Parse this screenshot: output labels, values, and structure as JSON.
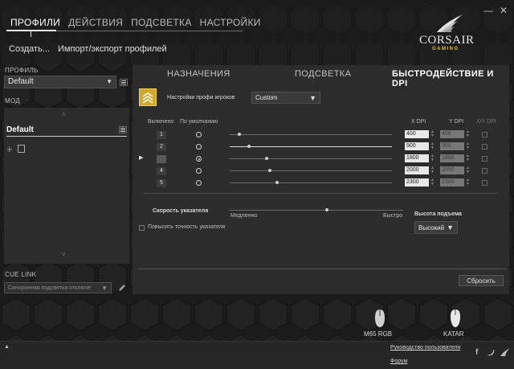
{
  "nav": {
    "tabs": [
      "ПРОФИЛИ",
      "ДЕЙСТВИЯ",
      "ПОДСВЕТКА",
      "НАСТРОЙКИ"
    ],
    "active_tab": "ПРОФИЛИ"
  },
  "window_controls": [
    "minimize-icon",
    "close-icon"
  ],
  "logo": {
    "brand": "CORSAIR",
    "tagline": "GAMING"
  },
  "subnav": {
    "create": "Создать...",
    "import_export": "Импорт/экспорт профилей"
  },
  "profile": {
    "label": "ПРОФИЛЬ",
    "selected": "Default"
  },
  "mode": {
    "label": "МОД",
    "selected": "Default"
  },
  "cue_link": {
    "label": "CUE LINK",
    "selected": "Синхронная подсветка отключе"
  },
  "main_tabs": [
    "НАЗНАЧЕНИЯ",
    "ПОДСВЕТКА",
    "БЫСТРОДЕЙСТВИЕ И DPI"
  ],
  "active_main_tab": "БЫСТРОДЕЙСТВИЕ И DPI",
  "gamer_settings": {
    "label": "Настройки профи игроков",
    "selected": "Custom"
  },
  "dpi_table": {
    "headers": {
      "enabled": "Включено",
      "default": "По умолчанию",
      "xdpi": "X DPI",
      "ydpi": "Y DPI",
      "xy": "X/Y DPI"
    },
    "rows": [
      {
        "num": "1",
        "x": "400",
        "y": "400",
        "default": false,
        "slider": 0.05,
        "bright": false
      },
      {
        "num": "2",
        "x": "900",
        "y": "900",
        "default": false,
        "slider": 0.11,
        "bright": true
      },
      {
        "num": "3",
        "x": "1800",
        "y": "1800",
        "default": true,
        "slider": 0.22,
        "bright": false
      },
      {
        "num": "4",
        "x": "2000",
        "y": "2000",
        "default": false,
        "slider": 0.24,
        "bright": false
      },
      {
        "num": "5",
        "x": "2300",
        "y": "2300",
        "default": false,
        "slider": 0.28,
        "bright": false
      }
    ],
    "active_row_index": 2
  },
  "pointer_speed": {
    "label": "Скорость указателя",
    "min_label": "Медленно",
    "max_label": "Быстро",
    "value": 0.55
  },
  "enhance_precision": {
    "label": "Повысить точность указателя",
    "checked": false
  },
  "lift_height": {
    "label": "Высота подъема",
    "selected": "Высокий"
  },
  "reset_label": "Сбросить",
  "devices": [
    {
      "name": "M65 RGB"
    },
    {
      "name": "KATAR"
    }
  ],
  "footer": {
    "manual": "Руководство пользователя",
    "forum": "Форум",
    "socials": [
      "facebook-icon",
      "twitter-icon",
      "corsair-sails-icon"
    ]
  },
  "colors": {
    "background": "#1b1b1b",
    "panel": "#2c2c2c",
    "accent_gold": "#d2a82a",
    "text": "#cfcfcf"
  }
}
